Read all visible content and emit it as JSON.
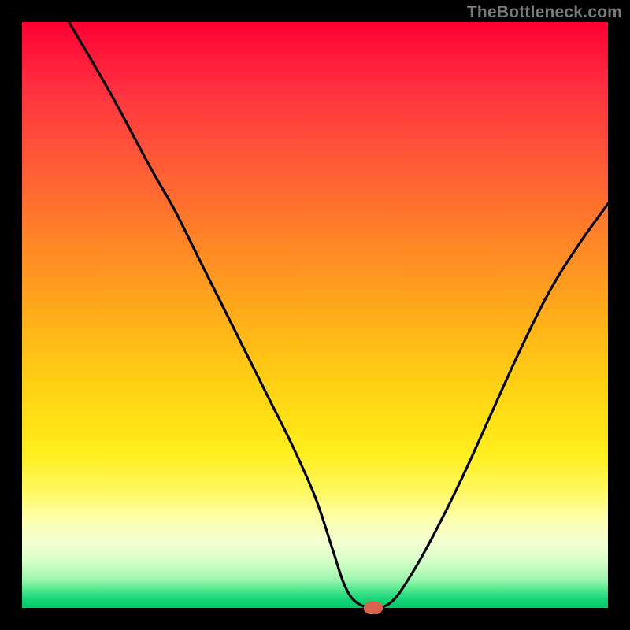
{
  "watermark": "TheBottleneck.com",
  "marker": {
    "color": "#d9624f"
  },
  "chart_data": {
    "type": "line",
    "title": "",
    "xlabel": "",
    "ylabel": "",
    "xlim": [
      0,
      100
    ],
    "ylim": [
      0,
      100
    ],
    "grid": false,
    "series": [
      {
        "name": "curve",
        "x": [
          8,
          15,
          22,
          26,
          30,
          34,
          38,
          42,
          46,
          50,
          53,
          55,
          57,
          60,
          63,
          66,
          70,
          75,
          80,
          85,
          90,
          95,
          100
        ],
        "y": [
          100,
          88,
          75,
          68,
          60,
          52,
          44,
          36,
          28,
          19,
          10,
          4,
          1,
          0,
          1,
          5,
          12,
          22,
          33,
          44,
          54,
          62,
          69
        ]
      }
    ],
    "marker_point": {
      "x": 60,
      "y": 0
    },
    "gradient_stops": [
      {
        "pos": 0,
        "color": "#ff0033"
      },
      {
        "pos": 0.5,
        "color": "#ffcc14"
      },
      {
        "pos": 0.85,
        "color": "#fdffb0"
      },
      {
        "pos": 1.0,
        "color": "#00cc66"
      }
    ]
  }
}
